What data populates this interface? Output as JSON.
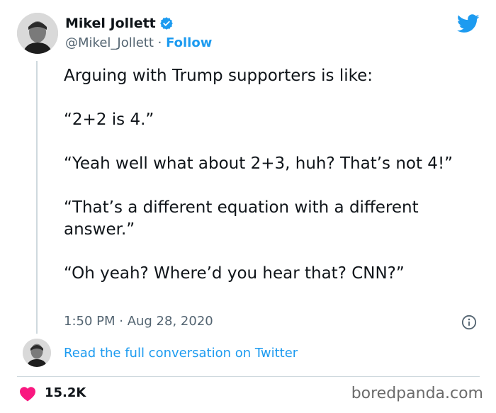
{
  "author": {
    "display_name": "Mikel Jollett",
    "handle": "@Mikel_Jollett",
    "separator": " · ",
    "follow_label": "Follow"
  },
  "tweet": {
    "paragraphs": [
      "Arguing with Trump supporters is like:",
      "“2+2 is 4.”",
      "“Yeah well what about 2+3, huh? That’s not 4!”",
      "“That’s a different equation with a different answer.”",
      "“Oh yeah? Where’d you hear that? CNN?”"
    ],
    "timestamp": "1:50 PM · Aug 28, 2020"
  },
  "conversation_link": "Read the full conversation on Twitter",
  "engagement": {
    "likes": "15.2K"
  },
  "watermark": "boredpanda.com",
  "icons": {
    "verified": "verified-badge-icon",
    "brand": "twitter-bird-icon",
    "info": "info-icon",
    "like": "heart-icon"
  },
  "colors": {
    "accent": "#1d9bf0",
    "secondary_text": "#536471",
    "like": "#f91880",
    "divider": "#cfd9de"
  }
}
